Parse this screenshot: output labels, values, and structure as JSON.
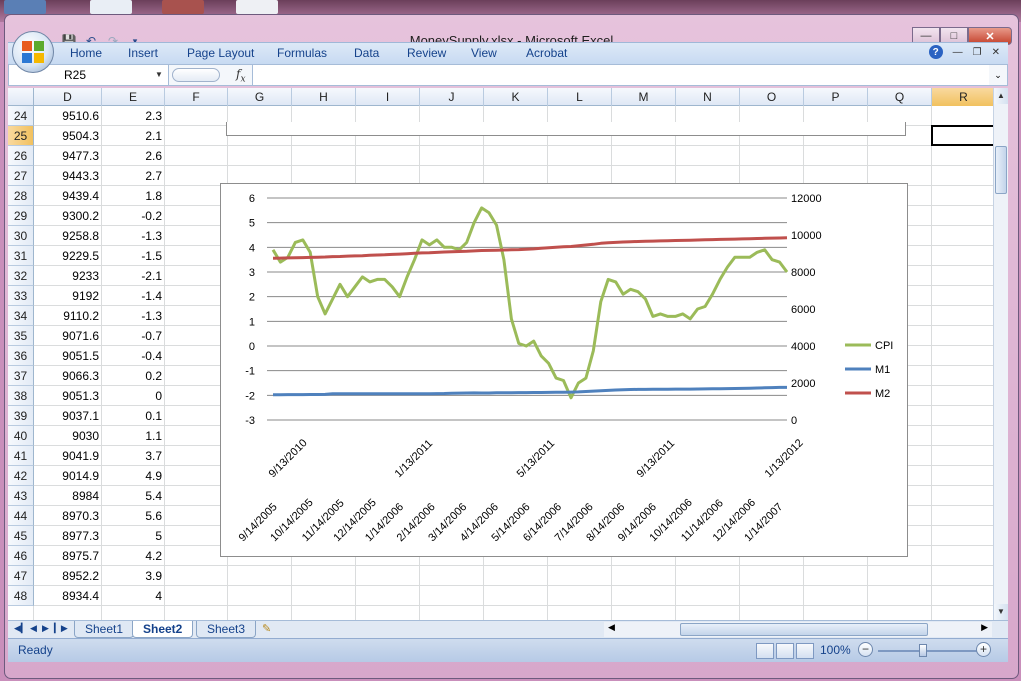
{
  "window": {
    "title": "MoneySupply.xlsx - Microsoft Excel"
  },
  "ribbon": {
    "tabs": [
      "Home",
      "Insert",
      "Page Layout",
      "Formulas",
      "Data",
      "Review",
      "View",
      "Acrobat"
    ]
  },
  "formula_bar": {
    "name_box": "R25",
    "fx": "fx",
    "value": ""
  },
  "columns": [
    "D",
    "E",
    "F",
    "G",
    "H",
    "I",
    "J",
    "K",
    "L",
    "M",
    "N",
    "O",
    "P",
    "Q",
    "R"
  ],
  "active_column": "R",
  "active_row": "25",
  "rows": [
    {
      "r": "24",
      "d": "9510.6",
      "e": "2.3"
    },
    {
      "r": "25",
      "d": "9504.3",
      "e": "2.1"
    },
    {
      "r": "26",
      "d": "9477.3",
      "e": "2.6"
    },
    {
      "r": "27",
      "d": "9443.3",
      "e": "2.7"
    },
    {
      "r": "28",
      "d": "9439.4",
      "e": "1.8"
    },
    {
      "r": "29",
      "d": "9300.2",
      "e": "-0.2"
    },
    {
      "r": "30",
      "d": "9258.8",
      "e": "-1.3"
    },
    {
      "r": "31",
      "d": "9229.5",
      "e": "-1.5"
    },
    {
      "r": "32",
      "d": "9233",
      "e": "-2.1"
    },
    {
      "r": "33",
      "d": "9192",
      "e": "-1.4"
    },
    {
      "r": "34",
      "d": "9110.2",
      "e": "-1.3"
    },
    {
      "r": "35",
      "d": "9071.6",
      "e": "-0.7"
    },
    {
      "r": "36",
      "d": "9051.5",
      "e": "-0.4"
    },
    {
      "r": "37",
      "d": "9066.3",
      "e": "0.2"
    },
    {
      "r": "38",
      "d": "9051.3",
      "e": "0"
    },
    {
      "r": "39",
      "d": "9037.1",
      "e": "0.1"
    },
    {
      "r": "40",
      "d": "9030",
      "e": "1.1"
    },
    {
      "r": "41",
      "d": "9041.9",
      "e": "3.7"
    },
    {
      "r": "42",
      "d": "9014.9",
      "e": "4.9"
    },
    {
      "r": "43",
      "d": "8984",
      "e": "5.4"
    },
    {
      "r": "44",
      "d": "8970.3",
      "e": "5.6"
    },
    {
      "r": "45",
      "d": "8977.3",
      "e": "5"
    },
    {
      "r": "46",
      "d": "8975.7",
      "e": "4.2"
    },
    {
      "r": "47",
      "d": "8952.2",
      "e": "3.9"
    },
    {
      "r": "48",
      "d": "8934.4",
      "e": "4"
    }
  ],
  "sheets": [
    "Sheet1",
    "Sheet2",
    "Sheet3"
  ],
  "active_sheet": "Sheet2",
  "status": {
    "text": "Ready",
    "zoom": "100%"
  },
  "chart_data": {
    "type": "line",
    "title": "",
    "y_left": {
      "range": [
        -3,
        6
      ],
      "ticks": [
        "6",
        "5",
        "4",
        "3",
        "2",
        "1",
        "0",
        "-1",
        "-2",
        "-3"
      ]
    },
    "y_right": {
      "range": [
        0,
        12000
      ],
      "ticks": [
        "12000",
        "10000",
        "8000",
        "6000",
        "4000",
        "2000",
        "0"
      ]
    },
    "x_top_labels": [
      "9/13/2010",
      "1/13/2011",
      "5/13/2011",
      "9/13/2011",
      "1/13/2012"
    ],
    "x_bottom_labels": [
      "9/14/2005",
      "10/14/2005",
      "11/14/2005",
      "12/14/2005",
      "1/14/2006",
      "2/14/2006",
      "3/14/2006",
      "4/14/2006",
      "5/14/2006",
      "6/14/2006",
      "7/14/2006",
      "8/14/2006",
      "9/14/2006",
      "10/14/2006",
      "11/14/2006",
      "12/14/2006",
      "1/14/2007"
    ],
    "legend_position": "right",
    "series": [
      {
        "name": "CPI",
        "axis": "left",
        "color": "#9bbb59",
        "values": [
          3.9,
          3.4,
          3.6,
          4.2,
          4.3,
          3.8,
          2.0,
          1.3,
          1.9,
          2.5,
          2.0,
          2.4,
          2.8,
          2.6,
          2.7,
          2.7,
          2.4,
          2.0,
          2.8,
          3.5,
          4.3,
          4.1,
          4.3,
          4.0,
          4.0,
          3.9,
          4.2,
          5.0,
          5.6,
          5.4,
          4.9,
          3.5,
          1.1,
          0.1,
          0.0,
          0.2,
          -0.4,
          -0.7,
          -1.3,
          -1.4,
          -2.1,
          -1.5,
          -1.3,
          -0.2,
          1.8,
          2.7,
          2.6,
          2.1,
          2.3,
          2.2,
          1.9,
          1.2,
          1.3,
          1.2,
          1.2,
          1.3,
          1.1,
          1.5,
          1.6,
          2.1,
          2.7,
          3.2,
          3.6,
          3.6,
          3.6,
          3.8,
          3.9,
          3.5,
          3.4,
          3.0
        ]
      },
      {
        "name": "M1",
        "axis": "right",
        "color": "#4f81bd",
        "values": [
          1370,
          1370,
          1372,
          1374,
          1375,
          1376,
          1380,
          1385,
          1420,
          1418,
          1416,
          1415,
          1417,
          1418,
          1420,
          1420,
          1419,
          1418,
          1420,
          1421,
          1420,
          1422,
          1425,
          1430,
          1450,
          1455,
          1460,
          1465,
          1460,
          1462,
          1470,
          1474,
          1478,
          1480,
          1482,
          1485,
          1488,
          1490,
          1495,
          1500,
          1510,
          1520,
          1540,
          1560,
          1580,
          1600,
          1620,
          1640,
          1650,
          1655,
          1655,
          1660,
          1662,
          1665,
          1668,
          1670,
          1672,
          1675,
          1680,
          1685,
          1690,
          1700,
          1705,
          1710,
          1720,
          1730,
          1740,
          1750,
          1760,
          1760
        ]
      },
      {
        "name": "M2",
        "axis": "right",
        "color": "#c0504d",
        "values": [
          8740,
          8750,
          8760,
          8770,
          8780,
          8790,
          8800,
          8810,
          8830,
          8840,
          8860,
          8870,
          8880,
          8900,
          8920,
          8930,
          8950,
          8970,
          8990,
          9010,
          9030,
          9040,
          9060,
          9080,
          9100,
          9110,
          9120,
          9140,
          9160,
          9170,
          9180,
          9190,
          9200,
          9210,
          9230,
          9250,
          9280,
          9310,
          9340,
          9360,
          9380,
          9420,
          9460,
          9500,
          9550,
          9580,
          9600,
          9620,
          9640,
          9650,
          9660,
          9670,
          9680,
          9690,
          9700,
          9710,
          9720,
          9730,
          9740,
          9750,
          9760,
          9770,
          9780,
          9790,
          9800,
          9810,
          9820,
          9830,
          9840,
          9850
        ]
      }
    ]
  }
}
